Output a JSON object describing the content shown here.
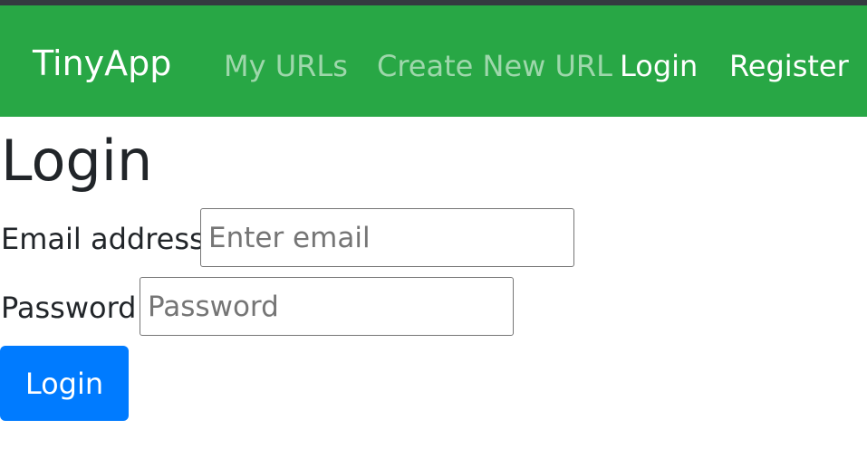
{
  "navbar": {
    "brand": "TinyApp",
    "links": [
      {
        "label": "My URLs"
      },
      {
        "label": "Create New URL"
      },
      {
        "label": "Login"
      },
      {
        "label": "Register"
      }
    ],
    "background": "#28a745",
    "muted_link_color": "rgba(255,255,255,0.55)"
  },
  "page": {
    "title": "Login",
    "form": {
      "email_label": "Email address",
      "email_placeholder": "Enter email",
      "email_value": "",
      "password_label": "Password",
      "password_placeholder": "Password",
      "password_value": "",
      "submit_label": "Login"
    }
  },
  "colors": {
    "topstrip": "#343a40",
    "button": "#007bff",
    "text": "#212529"
  }
}
